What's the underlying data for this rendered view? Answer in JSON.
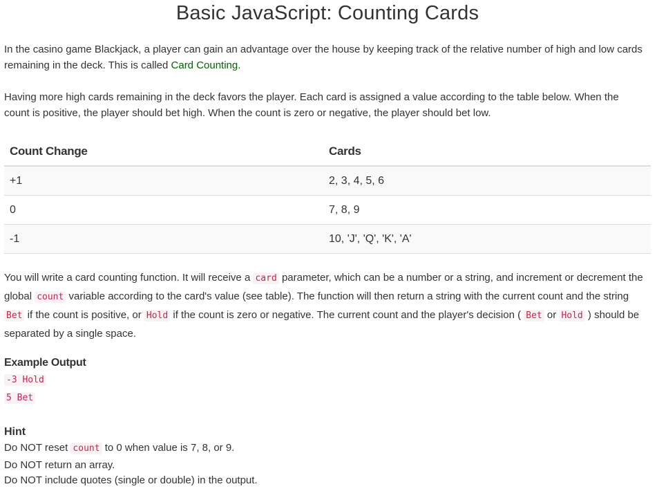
{
  "title": "Basic JavaScript: Counting Cards",
  "intro": {
    "text_before_link": "In the casino game Blackjack, a player can gain an advantage over the house by keeping track of the relative number of high and low cards remaining in the deck. This is called ",
    "link_text": "Card Counting",
    "text_after_link": "."
  },
  "rules_paragraph": "Having more high cards remaining in the deck favors the player. Each card is assigned a value according to the table below. When the count is positive, the player should bet high. When the count is zero or negative, the player should bet low.",
  "table": {
    "headers": [
      "Count Change",
      "Cards"
    ],
    "rows": [
      [
        "+1",
        "2, 3, 4, 5, 6"
      ],
      [
        "0",
        "7, 8, 9"
      ],
      [
        "-1",
        "10, 'J', 'Q', 'K', 'A'"
      ]
    ]
  },
  "instructions": {
    "t1": "You will write a card counting function. It will receive a ",
    "c1": "card",
    "t2": " parameter, which can be a number or a string, and increment or decrement the global ",
    "c2": "count",
    "t3": " variable according to the card's value (see table). The function will then return a string with the current count and the string ",
    "c3": "Bet",
    "t4": " if the count is positive, or ",
    "c4": "Hold",
    "t5": " if the count is zero or negative. The current count and the player's decision ( ",
    "c5": "Bet",
    "t6": " or ",
    "c6": "Hold",
    "t7": " ) should be separated by a single space."
  },
  "example": {
    "label": "Example Output",
    "lines": [
      "-3 Hold",
      "5 Bet"
    ]
  },
  "hint": {
    "label": "Hint",
    "line1_before": "Do NOT reset ",
    "line1_code": "count",
    "line1_after": " to 0 when value is 7, 8, or 9.",
    "line2": "Do NOT return an array.",
    "line3": "Do NOT include quotes (single or double) in the output."
  }
}
